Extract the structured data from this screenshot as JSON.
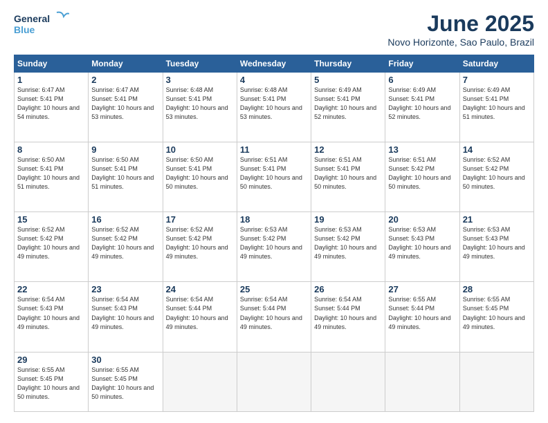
{
  "logo": {
    "line1": "General",
    "line2": "Blue"
  },
  "title": "June 2025",
  "location": "Novo Horizonte, Sao Paulo, Brazil",
  "headers": [
    "Sunday",
    "Monday",
    "Tuesday",
    "Wednesday",
    "Thursday",
    "Friday",
    "Saturday"
  ],
  "weeks": [
    [
      {
        "day": "1",
        "sunrise": "6:47 AM",
        "sunset": "5:41 PM",
        "daylight": "10 hours and 54 minutes."
      },
      {
        "day": "2",
        "sunrise": "6:47 AM",
        "sunset": "5:41 PM",
        "daylight": "10 hours and 53 minutes."
      },
      {
        "day": "3",
        "sunrise": "6:48 AM",
        "sunset": "5:41 PM",
        "daylight": "10 hours and 53 minutes."
      },
      {
        "day": "4",
        "sunrise": "6:48 AM",
        "sunset": "5:41 PM",
        "daylight": "10 hours and 53 minutes."
      },
      {
        "day": "5",
        "sunrise": "6:49 AM",
        "sunset": "5:41 PM",
        "daylight": "10 hours and 52 minutes."
      },
      {
        "day": "6",
        "sunrise": "6:49 AM",
        "sunset": "5:41 PM",
        "daylight": "10 hours and 52 minutes."
      },
      {
        "day": "7",
        "sunrise": "6:49 AM",
        "sunset": "5:41 PM",
        "daylight": "10 hours and 51 minutes."
      }
    ],
    [
      {
        "day": "8",
        "sunrise": "6:50 AM",
        "sunset": "5:41 PM",
        "daylight": "10 hours and 51 minutes."
      },
      {
        "day": "9",
        "sunrise": "6:50 AM",
        "sunset": "5:41 PM",
        "daylight": "10 hours and 51 minutes."
      },
      {
        "day": "10",
        "sunrise": "6:50 AM",
        "sunset": "5:41 PM",
        "daylight": "10 hours and 50 minutes."
      },
      {
        "day": "11",
        "sunrise": "6:51 AM",
        "sunset": "5:41 PM",
        "daylight": "10 hours and 50 minutes."
      },
      {
        "day": "12",
        "sunrise": "6:51 AM",
        "sunset": "5:41 PM",
        "daylight": "10 hours and 50 minutes."
      },
      {
        "day": "13",
        "sunrise": "6:51 AM",
        "sunset": "5:42 PM",
        "daylight": "10 hours and 50 minutes."
      },
      {
        "day": "14",
        "sunrise": "6:52 AM",
        "sunset": "5:42 PM",
        "daylight": "10 hours and 50 minutes."
      }
    ],
    [
      {
        "day": "15",
        "sunrise": "6:52 AM",
        "sunset": "5:42 PM",
        "daylight": "10 hours and 49 minutes."
      },
      {
        "day": "16",
        "sunrise": "6:52 AM",
        "sunset": "5:42 PM",
        "daylight": "10 hours and 49 minutes."
      },
      {
        "day": "17",
        "sunrise": "6:52 AM",
        "sunset": "5:42 PM",
        "daylight": "10 hours and 49 minutes."
      },
      {
        "day": "18",
        "sunrise": "6:53 AM",
        "sunset": "5:42 PM",
        "daylight": "10 hours and 49 minutes."
      },
      {
        "day": "19",
        "sunrise": "6:53 AM",
        "sunset": "5:42 PM",
        "daylight": "10 hours and 49 minutes."
      },
      {
        "day": "20",
        "sunrise": "6:53 AM",
        "sunset": "5:43 PM",
        "daylight": "10 hours and 49 minutes."
      },
      {
        "day": "21",
        "sunrise": "6:53 AM",
        "sunset": "5:43 PM",
        "daylight": "10 hours and 49 minutes."
      }
    ],
    [
      {
        "day": "22",
        "sunrise": "6:54 AM",
        "sunset": "5:43 PM",
        "daylight": "10 hours and 49 minutes."
      },
      {
        "day": "23",
        "sunrise": "6:54 AM",
        "sunset": "5:43 PM",
        "daylight": "10 hours and 49 minutes."
      },
      {
        "day": "24",
        "sunrise": "6:54 AM",
        "sunset": "5:44 PM",
        "daylight": "10 hours and 49 minutes."
      },
      {
        "day": "25",
        "sunrise": "6:54 AM",
        "sunset": "5:44 PM",
        "daylight": "10 hours and 49 minutes."
      },
      {
        "day": "26",
        "sunrise": "6:54 AM",
        "sunset": "5:44 PM",
        "daylight": "10 hours and 49 minutes."
      },
      {
        "day": "27",
        "sunrise": "6:55 AM",
        "sunset": "5:44 PM",
        "daylight": "10 hours and 49 minutes."
      },
      {
        "day": "28",
        "sunrise": "6:55 AM",
        "sunset": "5:45 PM",
        "daylight": "10 hours and 49 minutes."
      }
    ],
    [
      {
        "day": "29",
        "sunrise": "6:55 AM",
        "sunset": "5:45 PM",
        "daylight": "10 hours and 50 minutes."
      },
      {
        "day": "30",
        "sunrise": "6:55 AM",
        "sunset": "5:45 PM",
        "daylight": "10 hours and 50 minutes."
      },
      null,
      null,
      null,
      null,
      null
    ]
  ]
}
